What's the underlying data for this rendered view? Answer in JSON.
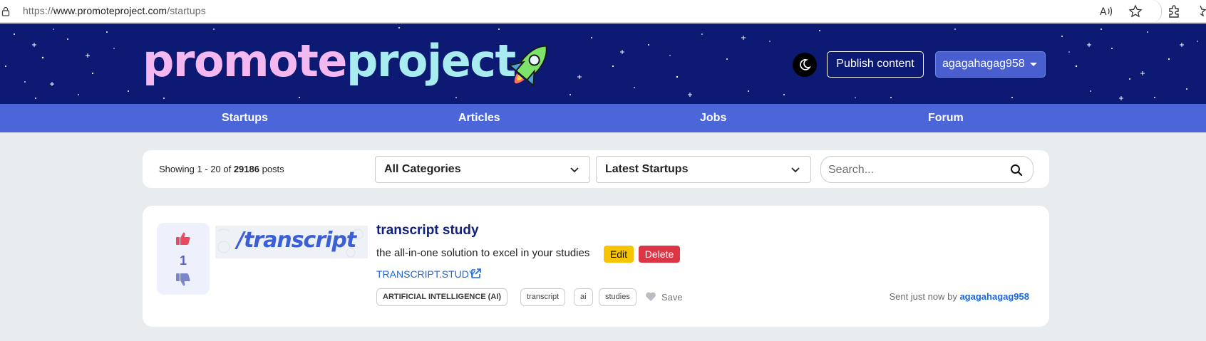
{
  "browser": {
    "url_scheme": "https://",
    "url_host": "www.promoteproject.com",
    "url_path": "/startups"
  },
  "header": {
    "logo_part1": "promote",
    "logo_part2": "project",
    "publish_label": "Publish content",
    "username": "agagahagag958"
  },
  "nav": {
    "items": [
      {
        "label": "Startups"
      },
      {
        "label": "Articles"
      },
      {
        "label": "Jobs"
      },
      {
        "label": "Forum"
      }
    ]
  },
  "filters": {
    "showing_prefix": "Showing 1 - 20 of",
    "total_posts": "29186",
    "showing_suffix": "posts",
    "category_selected": "All Categories",
    "sort_selected": "Latest Startups",
    "search_placeholder": "Search..."
  },
  "post": {
    "votes": "1",
    "thumb_text": "/transcript",
    "title": "transcript study",
    "description": "the all-in-one solution to excel in your studies",
    "edit_label": "Edit",
    "delete_label": "Delete",
    "link_text": "TRANSCRIPT.STUDY",
    "category_tag": "ARTIFICIAL INTELLIGENCE (AI)",
    "tags": [
      "transcript",
      "ai",
      "studies"
    ],
    "save_label": "Save",
    "sent_prefix": "Sent just now by",
    "author": "agagahagag958"
  },
  "colors": {
    "header_bg": "#0c1a74",
    "nav_bg": "#4a66d8",
    "logo_pink": "#f4b8f0",
    "logo_cyan": "#a8ecf0",
    "link_blue": "#1a66e0",
    "edit_yellow": "#f6c400",
    "delete_red": "#dc3545"
  }
}
